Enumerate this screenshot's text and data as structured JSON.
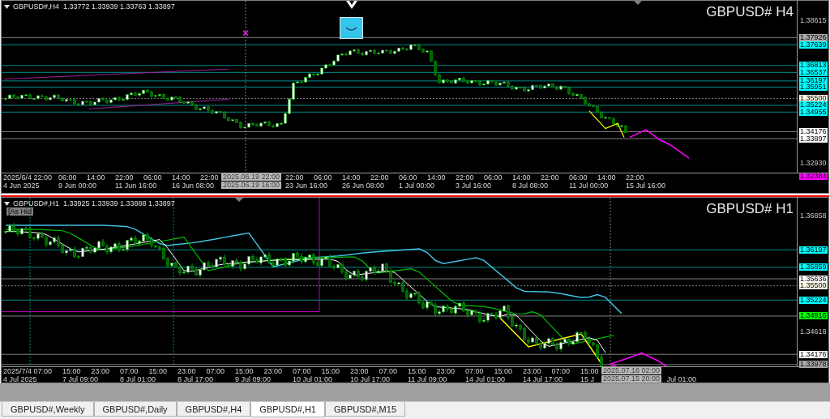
{
  "charts": [
    {
      "header": "GBPUSD#,H4  1.33772 1.33939 1.33763 1.33897",
      "title": "GBPUSD# H4",
      "price_labels": [
        {
          "text": "1.38615",
          "kind": "tick"
        },
        {
          "text": "1.37926",
          "kind": "tag",
          "color": "#a9a9a9"
        },
        {
          "text": "1.37639",
          "kind": "tag",
          "color": "#00ffff"
        },
        {
          "text": "1.36813",
          "kind": "tag",
          "color": "#00ffff"
        },
        {
          "text": "1.36537",
          "kind": "tag",
          "color": "#00ffff"
        },
        {
          "text": "1.36197",
          "kind": "tag",
          "color": "#00ffff"
        },
        {
          "text": "1.35951",
          "kind": "tag",
          "color": "#00ffff"
        },
        {
          "text": "1.35500",
          "kind": "tag",
          "color": "#fffbe6"
        },
        {
          "text": "1.35224",
          "kind": "tag",
          "color": "#00ffff"
        },
        {
          "text": "1.34955",
          "kind": "tag",
          "color": "#00ffff"
        },
        {
          "text": "1.34176",
          "kind": "tag",
          "color": "#ffffff"
        },
        {
          "text": "1.33897",
          "kind": "tag",
          "color": "#ffffff"
        },
        {
          "text": "1.32930",
          "kind": "tick"
        },
        {
          "text": "1.32384",
          "kind": "tag",
          "color": "#ff00ff"
        }
      ],
      "time_upper": [
        "2025/6/4 22:00",
        "06:00",
        "14:00",
        "22:00",
        "06:00",
        "14:00",
        "22:00",
        "22:00",
        "06:00",
        "14:00",
        "22:00",
        "06:00",
        "14:00",
        "22:00",
        "06:00",
        "14:00",
        "22:00",
        "06:00",
        "14:00",
        "22:00"
      ],
      "time_lower": [
        "4 Jun 2025",
        "9 Jun 00:00",
        "11 Jun 16:00",
        "16 Jun 08:00",
        "23 Jun 16:00",
        "26 Jun 08:00",
        "1 Jul 00:00",
        "3 Jul 16:00",
        "8 Jul 08:00",
        "11 Jul 00:00",
        "15 Jul 16:00"
      ],
      "crosshair_upper": "2025.06.19 22:00",
      "crosshair_lower": "2025.06.19 16:00"
    },
    {
      "header": "GBPUSD#,H1  1.33925 1.33939 1.33888 1.33897",
      "title": "GBPUSD# H1",
      "badge": "[As Hid",
      "price_labels": [
        {
          "text": "1.36858",
          "kind": "tick"
        },
        {
          "text": "1.36197",
          "kind": "tag",
          "color": "#00ffff"
        },
        {
          "text": "1.35859",
          "kind": "tag",
          "color": "#00ffff"
        },
        {
          "text": "1.35636",
          "kind": "tag",
          "color": "#ffffff"
        },
        {
          "text": "1.35500",
          "kind": "tag",
          "color": "#fffbe6"
        },
        {
          "text": "1.35224",
          "kind": "tag",
          "color": "#00ffff"
        },
        {
          "text": "1.34916",
          "kind": "tag",
          "color": "#00ff00"
        },
        {
          "text": "1.34618",
          "kind": "tick"
        },
        {
          "text": "1.34176",
          "kind": "tag",
          "color": "#ffffff"
        },
        {
          "text": "1.33978",
          "kind": "tag",
          "color": "#a9a9a9"
        }
      ],
      "time_upper": [
        "2025/7/4 07:00",
        "15:00",
        "23:00",
        "07:00",
        "15:00",
        "23:00",
        "07:00",
        "15:00",
        "23:00",
        "07:00",
        "15:00",
        "23:00",
        "07:00",
        "15:00",
        "23:00",
        "07:00",
        "15:00",
        "23:00",
        "07:00",
        "15:00"
      ],
      "time_lower": [
        "4 Jul 2025",
        "7 Jul 09:00",
        "8 Jul 01:00",
        "8 Jul 17:00",
        "9 Jul 09:00",
        "10 Jul 01:00",
        "10 Jul 17:00",
        "11 Jul 09:00",
        "14 Jul 01:00",
        "14 Jul 17:00",
        "15 J",
        "Jul 01:00"
      ],
      "crosshair_upper": "2025.07.16 02:00",
      "crosshair_lower": "2025.07.15 20:00"
    }
  ],
  "tabs": [
    {
      "label": "GBPUSD#,Weekly",
      "selected": false
    },
    {
      "label": "GBPUSD#,Daily",
      "selected": false
    },
    {
      "label": "GBPUSD#,H4",
      "selected": false
    },
    {
      "label": "GBPUSD#,H1",
      "selected": true
    },
    {
      "label": "GBPUSD#,M15",
      "selected": false
    }
  ]
}
